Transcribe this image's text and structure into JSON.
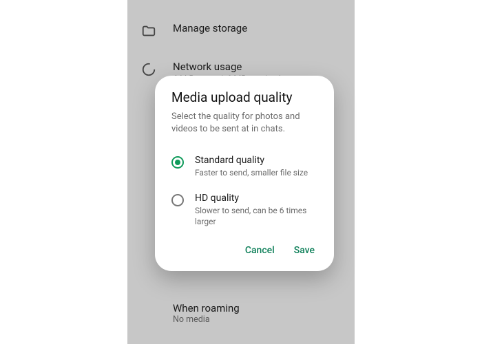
{
  "settings": {
    "items": [
      {
        "label": "Manage storage",
        "sub": ""
      },
      {
        "label": "Network usage",
        "sub": "64 kB sent · 1.6 MB received"
      }
    ],
    "roaming": {
      "label": "When roaming",
      "sub": "No media"
    }
  },
  "dialog": {
    "title": "Media upload quality",
    "description": "Select the quality for photos and videos to be sent at in chats.",
    "options": [
      {
        "label": "Standard quality",
        "sub": "Faster to send, smaller file size",
        "selected": true
      },
      {
        "label": "HD quality",
        "sub": "Slower to send, can be 6 times larger",
        "selected": false
      }
    ],
    "cancel_label": "Cancel",
    "save_label": "Save",
    "accent_color": "#0f805a"
  }
}
